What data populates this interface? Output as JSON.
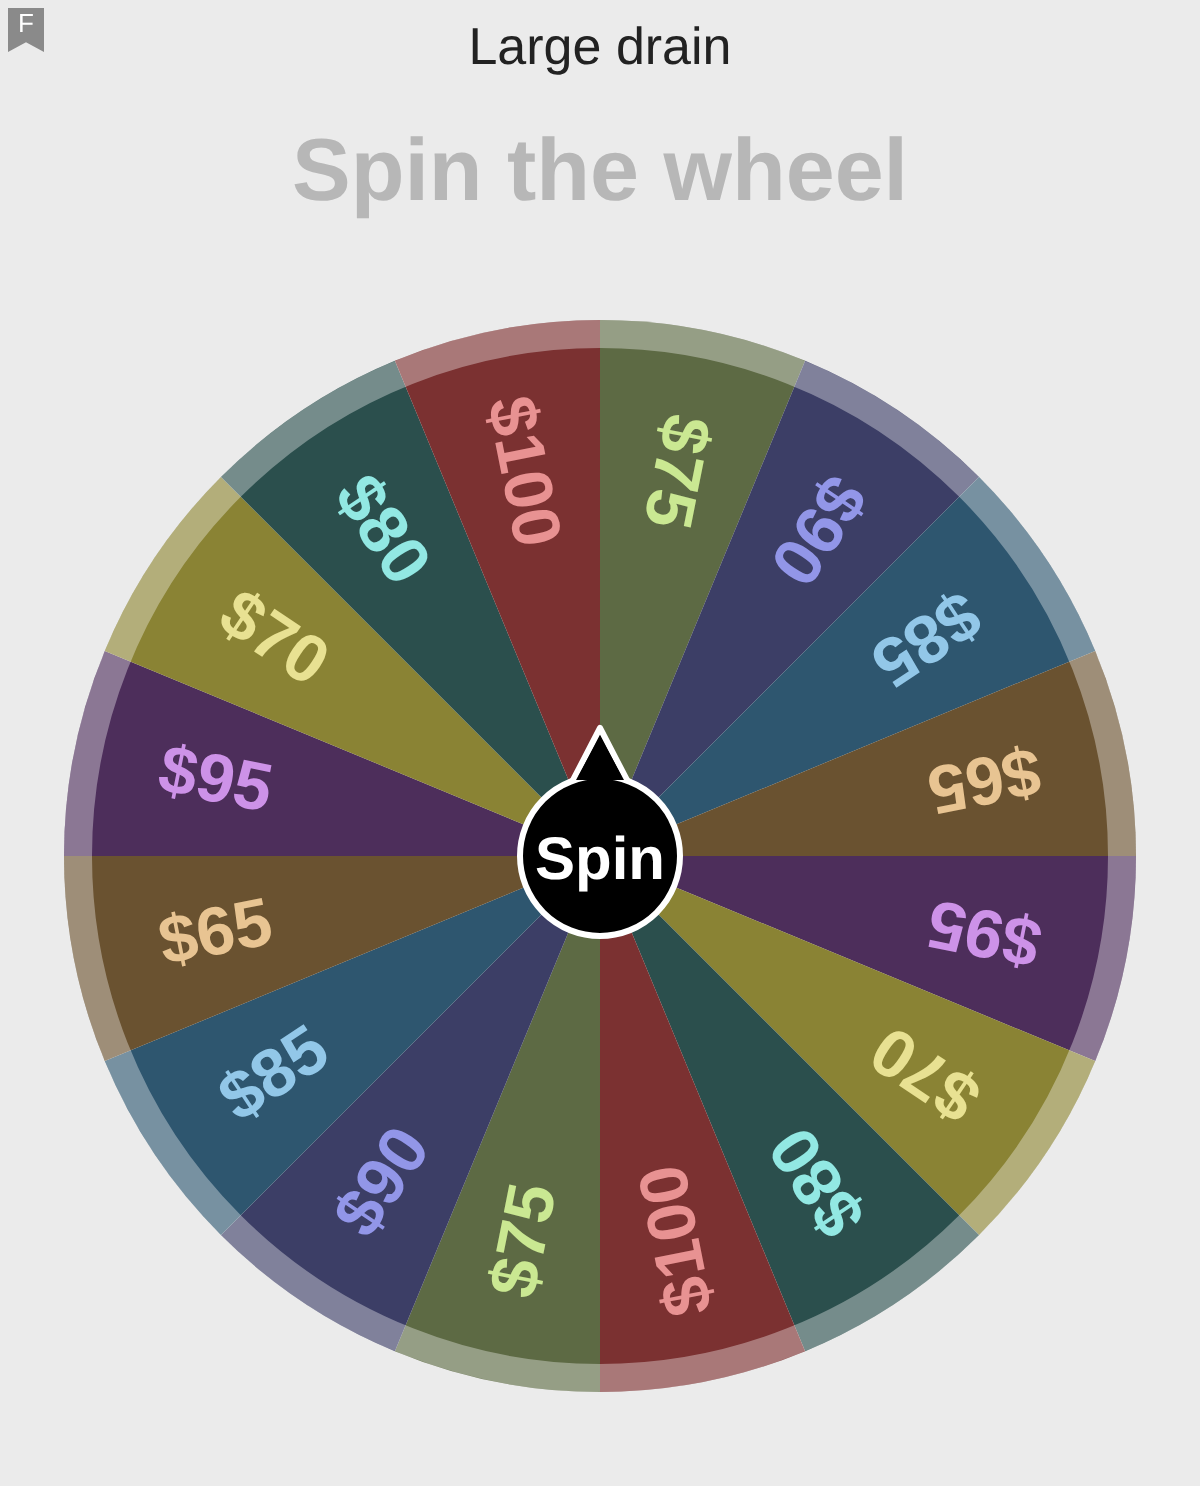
{
  "header": {
    "badge": "F",
    "title": "Large drain"
  },
  "heading": "Spin the wheel",
  "wheel": {
    "segments": [
      {
        "label": "$75",
        "color": "#5d6a44"
      },
      {
        "label": "$90",
        "color": "#3c3e66"
      },
      {
        "label": "$85",
        "color": "#2e566f"
      },
      {
        "label": "$65",
        "color": "#6a5230"
      },
      {
        "label": "$95",
        "color": "#4d2e5b"
      },
      {
        "label": "$70",
        "color": "#8a8334"
      },
      {
        "label": "$80",
        "color": "#2b4f4d"
      },
      {
        "label": "$100",
        "color": "#7b3131"
      },
      {
        "label": "$75",
        "color": "#5d6a44"
      },
      {
        "label": "$90",
        "color": "#3c3e66"
      },
      {
        "label": "$85",
        "color": "#2e566f"
      },
      {
        "label": "$65",
        "color": "#6a5230"
      },
      {
        "label": "$95",
        "color": "#4d2e5b"
      },
      {
        "label": "$70",
        "color": "#8a8334"
      },
      {
        "label": "$80",
        "color": "#2b4f4d"
      },
      {
        "label": "$100",
        "color": "#7b3131"
      }
    ],
    "button": "Spin"
  }
}
